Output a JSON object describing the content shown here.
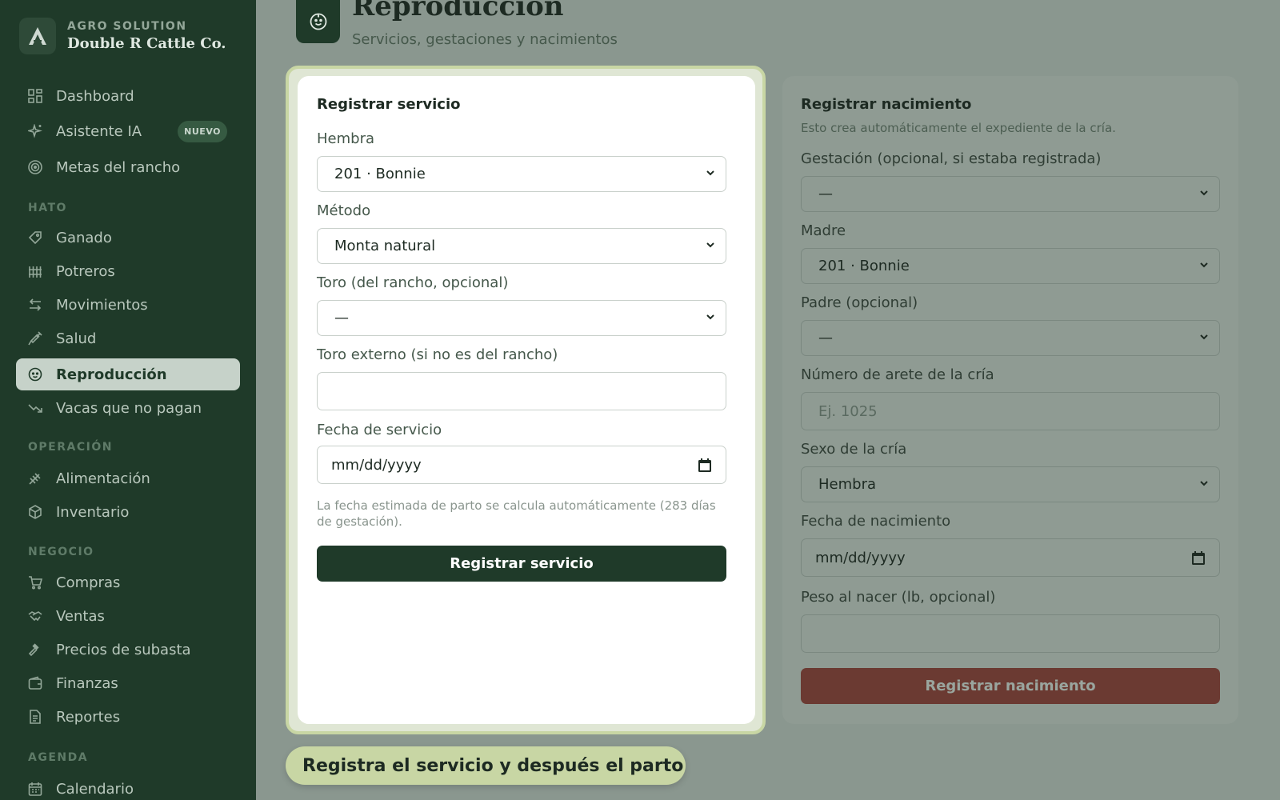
{
  "brand": {
    "company_type": "AGRO SOLUTION",
    "name": "Double R Cattle Co."
  },
  "sidebar": {
    "top_items": [
      {
        "label": "Dashboard",
        "icon": "grid-icon"
      },
      {
        "label": "Asistente IA",
        "icon": "sparkles-icon",
        "badge": "NUEVO"
      },
      {
        "label": "Metas del rancho",
        "icon": "target-icon"
      }
    ],
    "sections": {
      "hato": "HATO",
      "operacion": "OPERACIÓN",
      "negocio": "NEGOCIO",
      "agenda": "AGENDA"
    },
    "hato_items": [
      {
        "label": "Ganado",
        "icon": "tag-icon"
      },
      {
        "label": "Potreros",
        "icon": "fence-icon"
      },
      {
        "label": "Movimientos",
        "icon": "arrows-icon"
      },
      {
        "label": "Salud",
        "icon": "syringe-icon"
      },
      {
        "label": "Reproducción",
        "icon": "baby-icon",
        "active": true
      },
      {
        "label": "Vacas que no pagan",
        "icon": "trend-down-icon"
      }
    ],
    "operacion_items": [
      {
        "label": "Alimentación",
        "icon": "wheat-icon"
      },
      {
        "label": "Inventario",
        "icon": "box-icon"
      }
    ],
    "negocio_items": [
      {
        "label": "Compras",
        "icon": "cart-icon"
      },
      {
        "label": "Ventas",
        "icon": "handshake-icon"
      },
      {
        "label": "Precios de subasta",
        "icon": "gavel-icon"
      },
      {
        "label": "Finanzas",
        "icon": "wallet-icon"
      },
      {
        "label": "Reportes",
        "icon": "report-icon"
      }
    ],
    "agenda_items": [
      {
        "label": "Calendario",
        "icon": "calendar-icon"
      }
    ]
  },
  "header": {
    "title": "Reproducción",
    "subtitle": "Servicios, gestaciones y nacimientos"
  },
  "service_form": {
    "title": "Registrar servicio",
    "female_label": "Hembra",
    "female_value": "201 · Bonnie",
    "method_label": "Método",
    "method_value": "Monta natural",
    "bull_label": "Toro (del rancho, opcional)",
    "bull_value": "—",
    "external_bull_label": "Toro externo (si no es del rancho)",
    "external_bull_value": "",
    "date_label": "Fecha de servicio",
    "date_value": "mm/dd/yyyy",
    "hint": "La fecha estimada de parto se calcula automáticamente (283 días de gestación).",
    "submit": "Registrar servicio"
  },
  "birth_form": {
    "title": "Registrar nacimiento",
    "subtitle": "Esto crea automáticamente el expediente de la cría.",
    "gestation_label": "Gestación (opcional, si estaba registrada)",
    "gestation_value": "—",
    "mother_label": "Madre",
    "mother_value": "201 · Bonnie",
    "father_label": "Padre (opcional)",
    "father_value": "—",
    "tag_label": "Número de arete de la cría",
    "tag_placeholder": "Ej. 1025",
    "sex_label": "Sexo de la cría",
    "sex_value": "Hembra",
    "birth_date_label": "Fecha de nacimiento",
    "birth_date_value": "mm/dd/yyyy",
    "weight_label": "Peso al nacer (lb, opcional)",
    "weight_value": "",
    "submit": "Registrar nacimiento"
  },
  "tip": {
    "text": "Registra el servicio y después el parto"
  },
  "colors": {
    "sidebar": "#1f3a29",
    "accent": "#c8d6a4",
    "danger": "#6b3a32"
  }
}
